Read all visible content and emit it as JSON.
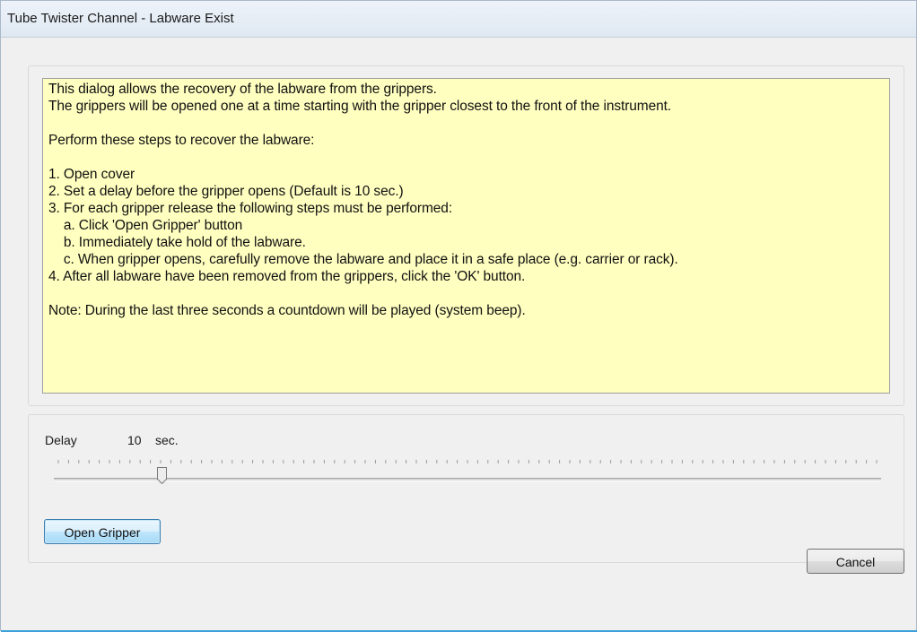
{
  "window": {
    "title": "Tube Twister Channel - Labware Exist"
  },
  "instructions": {
    "text": "This dialog allows the recovery of the labware from the grippers.\nThe grippers will be opened one at a time starting with the gripper closest to the front of the instrument.\n\nPerform these steps to recover the labware:\n\n1. Open cover\n2. Set a delay before the gripper opens (Default is 10 sec.)\n3. For each gripper release the following steps must be performed:\n    a. Click 'Open Gripper' button\n    b. Immediately take hold of the labware.\n    c. When gripper opens, carefully remove the labware and place it in a safe place (e.g. carrier or rack).\n4. After all labware have been removed from the grippers, click the 'OK' button.\n\nNote: During the last three seconds a countdown will be played (system beep).",
    "background": "#ffffc0"
  },
  "delay": {
    "label": "Delay",
    "value": "10",
    "unit": "sec.",
    "slider_min": 0,
    "slider_max": 80,
    "slider_value": 10
  },
  "buttons": {
    "open_gripper": "Open Gripper",
    "cancel": "Cancel"
  },
  "colors": {
    "accent": "#3c9fd8",
    "dialog_bg": "#f0f0f0"
  }
}
